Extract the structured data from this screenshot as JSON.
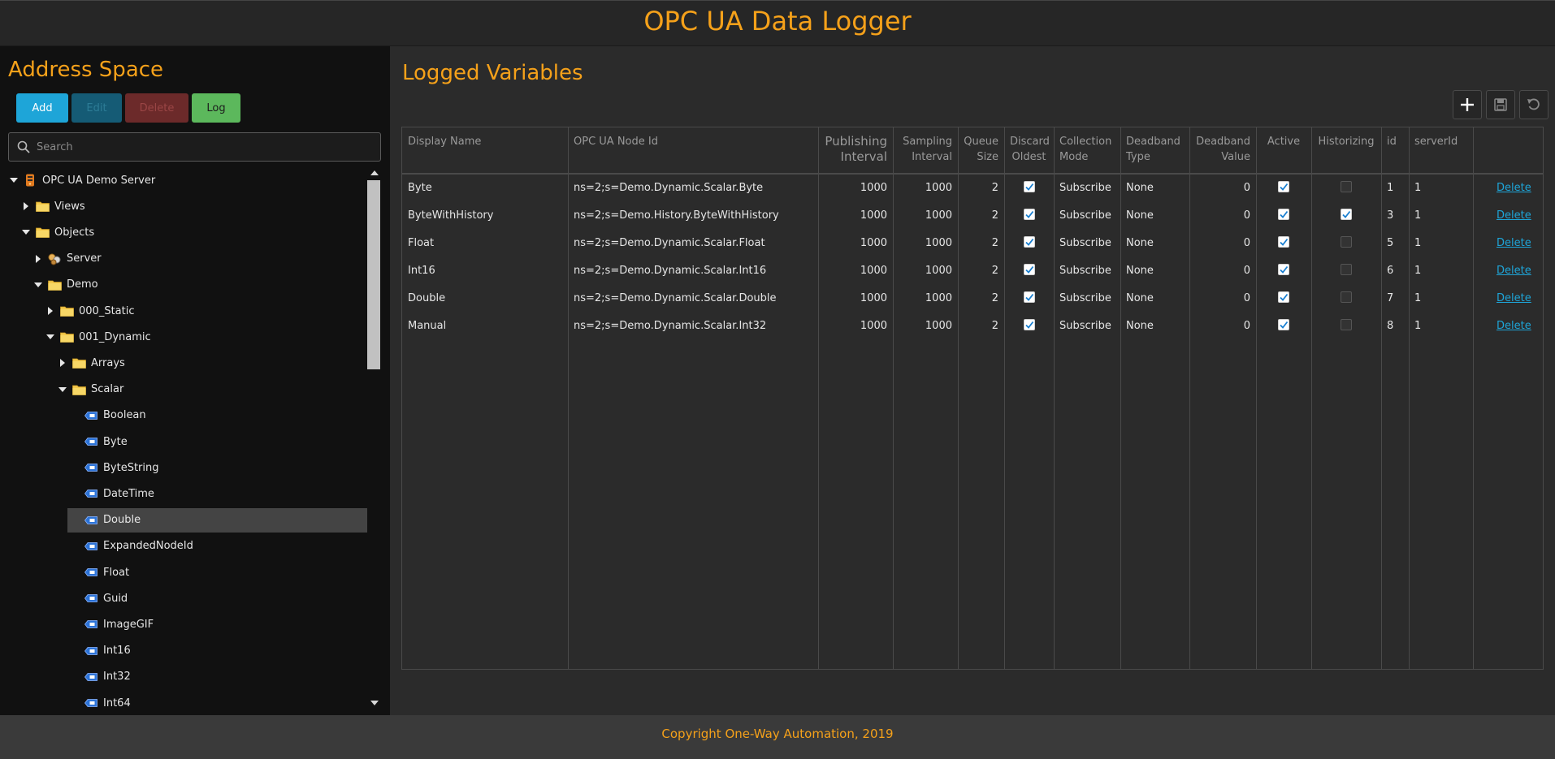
{
  "header": {
    "title": "OPC UA Data Logger"
  },
  "left": {
    "title": "Address Space",
    "buttons": {
      "add": "Add",
      "edit": "Edit",
      "delete": "Delete",
      "log": "Log"
    },
    "search": {
      "placeholder": "Search",
      "value": ""
    },
    "tree": [
      {
        "label": "OPC UA Demo Server",
        "depth": 0,
        "state": "expanded",
        "icon": "server-icon"
      },
      {
        "label": "Views",
        "depth": 1,
        "state": "collapsed",
        "icon": "folder-icon"
      },
      {
        "label": "Objects",
        "depth": 1,
        "state": "expanded",
        "icon": "folder-icon"
      },
      {
        "label": "Server",
        "depth": 2,
        "state": "collapsed",
        "icon": "object-icon"
      },
      {
        "label": "Demo",
        "depth": 2,
        "state": "expanded",
        "icon": "folder-icon"
      },
      {
        "label": "000_Static",
        "depth": 3,
        "state": "collapsed",
        "icon": "folder-icon"
      },
      {
        "label": "001_Dynamic",
        "depth": 3,
        "state": "expanded",
        "icon": "folder-icon"
      },
      {
        "label": "Arrays",
        "depth": 4,
        "state": "collapsed",
        "icon": "folder-icon"
      },
      {
        "label": "Scalar",
        "depth": 4,
        "state": "expanded",
        "icon": "folder-icon"
      },
      {
        "label": "Boolean",
        "depth": 5,
        "state": "leaf",
        "icon": "variable-icon"
      },
      {
        "label": "Byte",
        "depth": 5,
        "state": "leaf",
        "icon": "variable-icon"
      },
      {
        "label": "ByteString",
        "depth": 5,
        "state": "leaf",
        "icon": "variable-icon"
      },
      {
        "label": "DateTime",
        "depth": 5,
        "state": "leaf",
        "icon": "variable-icon"
      },
      {
        "label": "Double",
        "depth": 5,
        "state": "leaf",
        "icon": "variable-icon",
        "selected": true
      },
      {
        "label": "ExpandedNodeId",
        "depth": 5,
        "state": "leaf",
        "icon": "variable-icon"
      },
      {
        "label": "Float",
        "depth": 5,
        "state": "leaf",
        "icon": "variable-icon"
      },
      {
        "label": "Guid",
        "depth": 5,
        "state": "leaf",
        "icon": "variable-icon"
      },
      {
        "label": "ImageGIF",
        "depth": 5,
        "state": "leaf",
        "icon": "variable-icon"
      },
      {
        "label": "Int16",
        "depth": 5,
        "state": "leaf",
        "icon": "variable-icon"
      },
      {
        "label": "Int32",
        "depth": 5,
        "state": "leaf",
        "icon": "variable-icon"
      },
      {
        "label": "Int64",
        "depth": 5,
        "state": "leaf",
        "icon": "variable-icon"
      }
    ]
  },
  "right": {
    "title": "Logged Variables",
    "toolbar": [
      "add-icon",
      "save-icon",
      "undo-icon"
    ],
    "columns": [
      {
        "key": "displayName",
        "label": "Display Name"
      },
      {
        "key": "nodeId",
        "label": "OPC UA Node Id"
      },
      {
        "key": "publishingInterval",
        "label": "Publishing\nInterval"
      },
      {
        "key": "samplingInterval",
        "label": "Sampling\nInterval"
      },
      {
        "key": "queueSize",
        "label": "Queue\nSize"
      },
      {
        "key": "discardOldest",
        "label": "Discard\nOldest"
      },
      {
        "key": "collectionMode",
        "label": "Collection\nMode"
      },
      {
        "key": "deadbandType",
        "label": "Deadband\nType"
      },
      {
        "key": "deadbandValue",
        "label": "Deadband\nValue"
      },
      {
        "key": "active",
        "label": "Active"
      },
      {
        "key": "historizing",
        "label": "Historizing"
      },
      {
        "key": "id",
        "label": "id"
      },
      {
        "key": "serverId",
        "label": "serverId"
      },
      {
        "key": "action",
        "label": ""
      }
    ],
    "rows": [
      {
        "displayName": "Byte",
        "nodeId": "ns=2;s=Demo.Dynamic.Scalar.Byte",
        "publishingInterval": "1000",
        "samplingInterval": "1000",
        "queueSize": "2",
        "discardOldest": true,
        "collectionMode": "Subscribe",
        "deadbandType": "None",
        "deadbandValue": "0",
        "active": true,
        "historizing": false,
        "id": "1",
        "serverId": "1",
        "action": "Delete"
      },
      {
        "displayName": "ByteWithHistory",
        "nodeId": "ns=2;s=Demo.History.ByteWithHistory",
        "publishingInterval": "1000",
        "samplingInterval": "1000",
        "queueSize": "2",
        "discardOldest": true,
        "collectionMode": "Subscribe",
        "deadbandType": "None",
        "deadbandValue": "0",
        "active": true,
        "historizing": true,
        "id": "3",
        "serverId": "1",
        "action": "Delete"
      },
      {
        "displayName": "Float",
        "nodeId": "ns=2;s=Demo.Dynamic.Scalar.Float",
        "publishingInterval": "1000",
        "samplingInterval": "1000",
        "queueSize": "2",
        "discardOldest": true,
        "collectionMode": "Subscribe",
        "deadbandType": "None",
        "deadbandValue": "0",
        "active": true,
        "historizing": false,
        "id": "5",
        "serverId": "1",
        "action": "Delete"
      },
      {
        "displayName": "Int16",
        "nodeId": "ns=2;s=Demo.Dynamic.Scalar.Int16",
        "publishingInterval": "1000",
        "samplingInterval": "1000",
        "queueSize": "2",
        "discardOldest": true,
        "collectionMode": "Subscribe",
        "deadbandType": "None",
        "deadbandValue": "0",
        "active": true,
        "historizing": false,
        "id": "6",
        "serverId": "1",
        "action": "Delete"
      },
      {
        "displayName": "Double",
        "nodeId": "ns=2;s=Demo.Dynamic.Scalar.Double",
        "publishingInterval": "1000",
        "samplingInterval": "1000",
        "queueSize": "2",
        "discardOldest": true,
        "collectionMode": "Subscribe",
        "deadbandType": "None",
        "deadbandValue": "0",
        "active": true,
        "historizing": false,
        "id": "7",
        "serverId": "1",
        "action": "Delete"
      },
      {
        "displayName": "Manual",
        "nodeId": "ns=2;s=Demo.Dynamic.Scalar.Int32",
        "publishingInterval": "1000",
        "samplingInterval": "1000",
        "queueSize": "2",
        "discardOldest": true,
        "collectionMode": "Subscribe",
        "deadbandType": "None",
        "deadbandValue": "0",
        "active": true,
        "historizing": false,
        "id": "8",
        "serverId": "1",
        "action": "Delete"
      }
    ]
  },
  "footer": {
    "copyright": "Copyright One-Way Automation, 2019"
  },
  "colors": {
    "accent": "#f5a11a",
    "link": "#1ea5d8",
    "add": "#1ea5d8",
    "log": "#5cb85c"
  }
}
